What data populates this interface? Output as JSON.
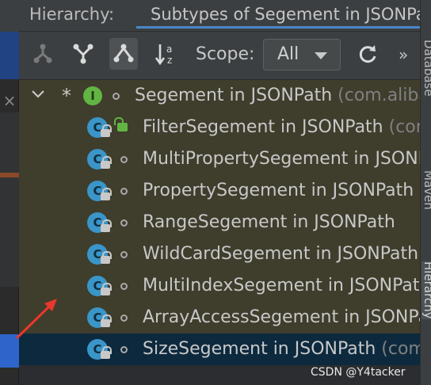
{
  "header": {
    "title": "Hierarchy:",
    "active_tab": "Subtypes of Segement in JSONPath"
  },
  "toolbar": {
    "buttons": [
      {
        "name": "type-hierarchy-icon"
      },
      {
        "name": "supertypes-hierarchy-icon"
      },
      {
        "name": "subtypes-hierarchy-icon",
        "active": true
      },
      {
        "name": "sort-alphabetically-icon"
      }
    ],
    "scope_label": "Scope:",
    "scope_value": "All",
    "refresh_icon": "refresh-icon",
    "more_label": "»"
  },
  "tree": {
    "root": {
      "label": "Segement in JSONPath",
      "package": "(com.alibaba.fastjson)",
      "icon": "interface-icon",
      "modifier": "*"
    },
    "children": [
      {
        "label": "FilterSegement in JSONPath",
        "package": "(com.alibaba.fastjson)",
        "icon": "class-icon",
        "access": "public"
      },
      {
        "label": "MultiPropertySegement in JSONPath",
        "package": "",
        "icon": "class-icon",
        "access": "package"
      },
      {
        "label": "PropertySegement in JSONPath",
        "package": "",
        "icon": "class-icon",
        "access": "package"
      },
      {
        "label": "RangeSegement in JSONPath",
        "package": "",
        "icon": "class-icon",
        "access": "package"
      },
      {
        "label": "WildCardSegement in JSONPath",
        "package": "",
        "icon": "class-icon",
        "access": "package"
      },
      {
        "label": "MultiIndexSegement in JSONPath",
        "package": "",
        "icon": "class-icon",
        "access": "package"
      },
      {
        "label": "ArrayAccessSegement in JSONPath",
        "package": "",
        "icon": "class-icon",
        "access": "package"
      },
      {
        "label": "SizeSegement in JSONPath",
        "package": "(com.alibaba.fastjson)",
        "icon": "class-icon",
        "access": "package",
        "selected": true
      }
    ]
  },
  "right_strip": {
    "tabs": [
      "Database",
      "Maven",
      "Hierarchy"
    ]
  },
  "left_strip": {
    "close_label": "×"
  },
  "watermark": "CSDN @Y4tacker",
  "colors": {
    "panel_bg": "#3c3f41",
    "tree_bg": "#3f3d2c",
    "selection": "#0d293e",
    "accent": "#4a88c7",
    "class_icon": "#3a95c8",
    "interface_icon": "#62b543",
    "annotation_arrow": "#e8372c"
  }
}
